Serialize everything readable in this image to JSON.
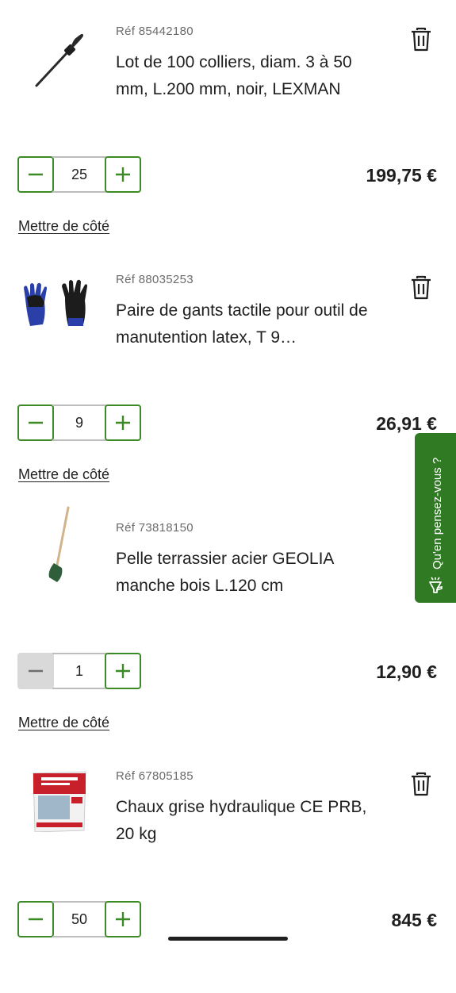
{
  "items": [
    {
      "ref": "Réf  85442180",
      "title": "Lot de 100 colliers, diam. 3 à 50 mm, L.200 mm, noir, LEXMAN",
      "quantity": "25",
      "price": "199,75 €",
      "save_label": "Mettre de côté",
      "thumbnail": "cable-tie-image",
      "minus_disabled": false
    },
    {
      "ref": "Réf  88035253",
      "title": "Paire de gants tactile pour outil de manutention latex, T 9…",
      "quantity": "9",
      "price": "26,91 €",
      "save_label": "Mettre de côté",
      "thumbnail": "gloves-image",
      "minus_disabled": false
    },
    {
      "ref": "Réf  73818150",
      "title": "Pelle terrassier acier GEOLIA manche bois L.120 cm",
      "quantity": "1",
      "price": "12,90 €",
      "save_label": "Mettre de côté",
      "thumbnail": "shovel-image",
      "minus_disabled": true
    },
    {
      "ref": "Réf  67805185",
      "title": "Chaux grise hydraulique CE PRB, 20 kg",
      "quantity": "50",
      "price": "845 €",
      "save_label": "",
      "thumbnail": "lime-bag-image",
      "minus_disabled": false
    }
  ],
  "feedback": {
    "label": "Qu'en pensez-vous ?",
    "icon": "megaphone-icon"
  },
  "colors": {
    "accent": "#3b8a25",
    "feedback_bg": "#2f7a23",
    "disabled": "#d9d9d9"
  },
  "icons": {
    "delete": "trash-icon",
    "decrease": "minus-icon",
    "increase": "plus-icon"
  }
}
